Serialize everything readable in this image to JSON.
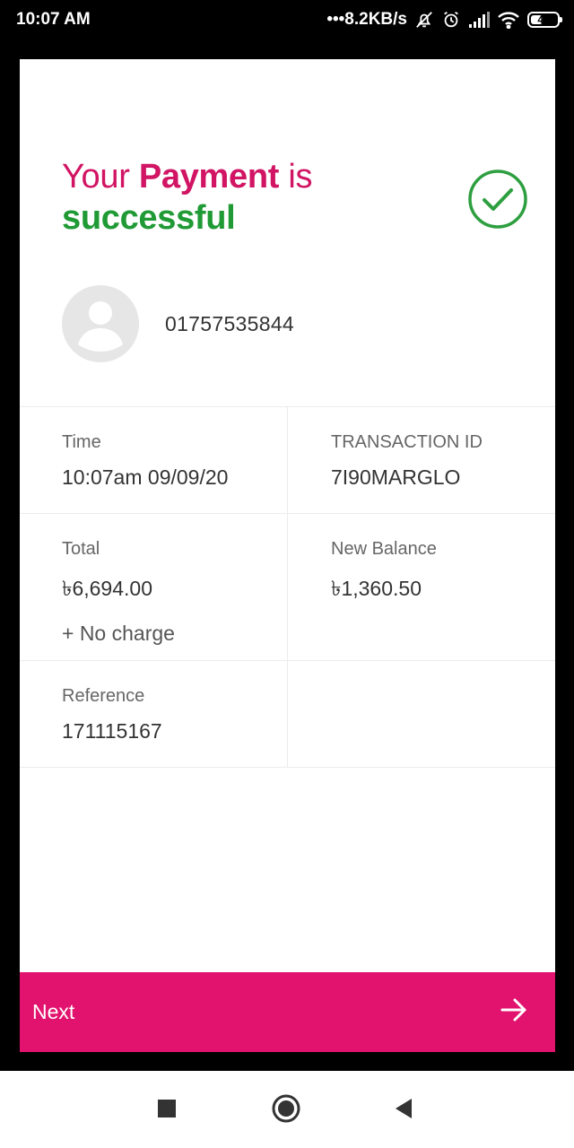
{
  "status_bar": {
    "time": "10:07 AM",
    "network_speed": "•••8.2KB/s",
    "battery": "41",
    "battery_level": 0.41,
    "icons": [
      "mute-bell-icon",
      "alarm-icon",
      "signal-icon",
      "wifi-icon",
      "battery-icon"
    ]
  },
  "headline": {
    "part1": "Your ",
    "part2": "Payment",
    "part3": " is",
    "line2": "successful"
  },
  "account": {
    "number": "01757535844"
  },
  "details": {
    "time_label": "Time",
    "time_value": "10:07am 09/09/20",
    "txn_label": "TRANSACTION ID",
    "txn_value": "7I90MARGLO",
    "total_label": "Total",
    "total_value": "৳6,694.00",
    "charge_text": "+ No charge",
    "balance_label": "New Balance",
    "balance_value": "৳1,360.50",
    "reference_label": "Reference",
    "reference_value": "171115167"
  },
  "footer": {
    "next_label": "Next"
  },
  "colors": {
    "brand_pink": "#e2136e",
    "headline_pink": "#d11463",
    "success_green": "#1f9a35"
  }
}
